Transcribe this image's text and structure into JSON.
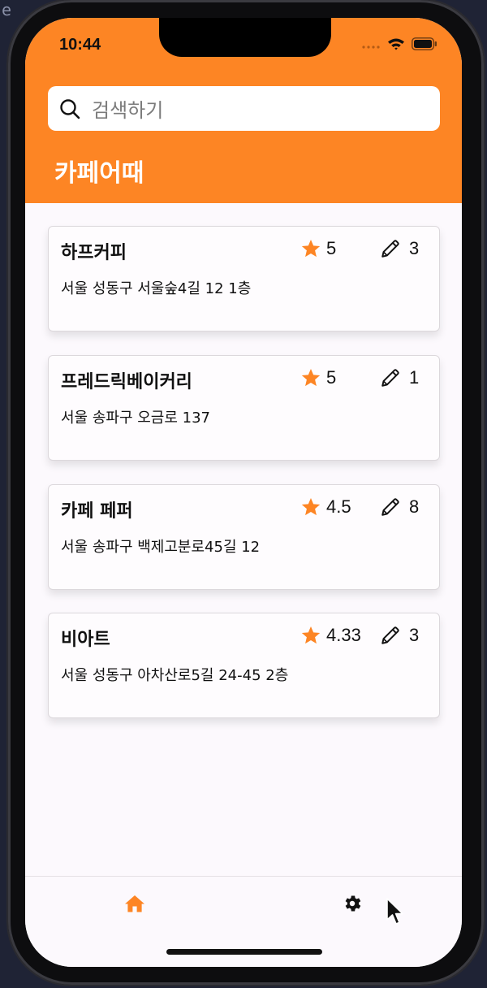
{
  "status_bar": {
    "time": "10:44"
  },
  "search": {
    "placeholder": "검색하기",
    "icon": "search-icon"
  },
  "app": {
    "title": "카페어때",
    "accent_color": "#fd8524"
  },
  "cafes": [
    {
      "name": "하프커피",
      "rating": "5",
      "review_count": "3",
      "address": "서울 성동구 서울숲4길 12 1층"
    },
    {
      "name": "프레드릭베이커리",
      "rating": "5",
      "review_count": "1",
      "address": "서울 송파구 오금로 137"
    },
    {
      "name": "카페 페퍼",
      "rating": "4.5",
      "review_count": "8",
      "address": "서울 송파구 백제고분로45길 12"
    },
    {
      "name": "비아트",
      "rating": "4.33",
      "review_count": "3",
      "address": "서울 성동구 아차산로5길 24-45 2층"
    }
  ],
  "bottom_nav": {
    "items": [
      {
        "icon": "home-icon",
        "active": true
      },
      {
        "icon": "gear-icon",
        "active": false
      }
    ]
  },
  "background": {
    "top_left_text": "e"
  }
}
